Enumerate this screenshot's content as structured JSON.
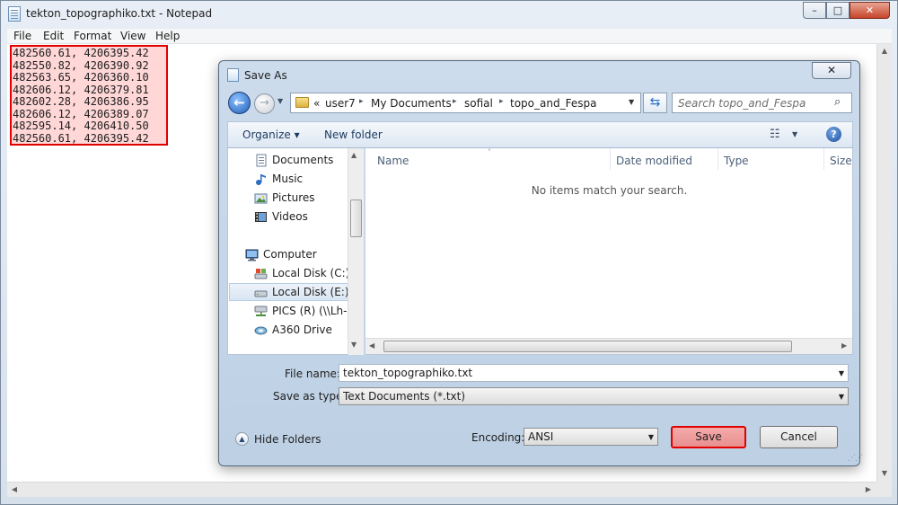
{
  "notepad": {
    "title": "tekton_topographiko.txt - Notepad",
    "menu": [
      "File",
      "Edit",
      "Format",
      "View",
      "Help"
    ],
    "lines": [
      "482560.61, 4206395.42",
      "482550.82, 4206390.92",
      "482563.65, 4206360.10",
      "482606.12, 4206379.81",
      "482602.28, 4206386.95",
      "482606.12, 4206389.07",
      "482595.14, 4206410.50",
      "482560.61, 4206395.42"
    ],
    "window_buttons": {
      "minimize": "–",
      "maximize": "□",
      "close": "✕"
    }
  },
  "dialog": {
    "title": "Save As",
    "close_glyph": "✕",
    "breadcrumb": {
      "overflow": "«",
      "items": [
        "user7",
        "My Documents",
        "sofial",
        "topo_and_Fespa"
      ],
      "separator": "▸"
    },
    "search_placeholder": "Search topo_and_Fespa",
    "toolbar": {
      "organize": "Organize ▾",
      "new_folder": "New folder"
    },
    "nav_items": [
      {
        "label": "Documents",
        "icon": "documents-icon"
      },
      {
        "label": "Music",
        "icon": "music-icon"
      },
      {
        "label": "Pictures",
        "icon": "pictures-icon"
      },
      {
        "label": "Videos",
        "icon": "videos-icon"
      },
      {
        "label": "Computer",
        "icon": "computer-icon"
      },
      {
        "label": "Local Disk (C:)",
        "icon": "local-disk-icon"
      },
      {
        "label": "Local Disk (E:)",
        "icon": "local-disk-icon",
        "selected": true
      },
      {
        "label": "PICS (R) (\\\\Lh-p",
        "icon": "network-drive-icon"
      },
      {
        "label": "A360 Drive",
        "icon": "cloud-drive-icon"
      }
    ],
    "columns": [
      "Name",
      "Date modified",
      "Type",
      "Size"
    ],
    "empty_message": "No items match your search.",
    "file_name_label": "File name:",
    "file_name_value": "tekton_topographiko.txt",
    "save_type_label": "Save as type:",
    "save_type_value": "Text Documents (*.txt)",
    "hide_folders": "Hide Folders",
    "encoding_label": "Encoding:",
    "encoding_value": "ANSI",
    "save_button": "Save",
    "cancel_button": "Cancel"
  },
  "colors": {
    "highlight_border": "#e00000",
    "accent": "#1f5fb8"
  }
}
